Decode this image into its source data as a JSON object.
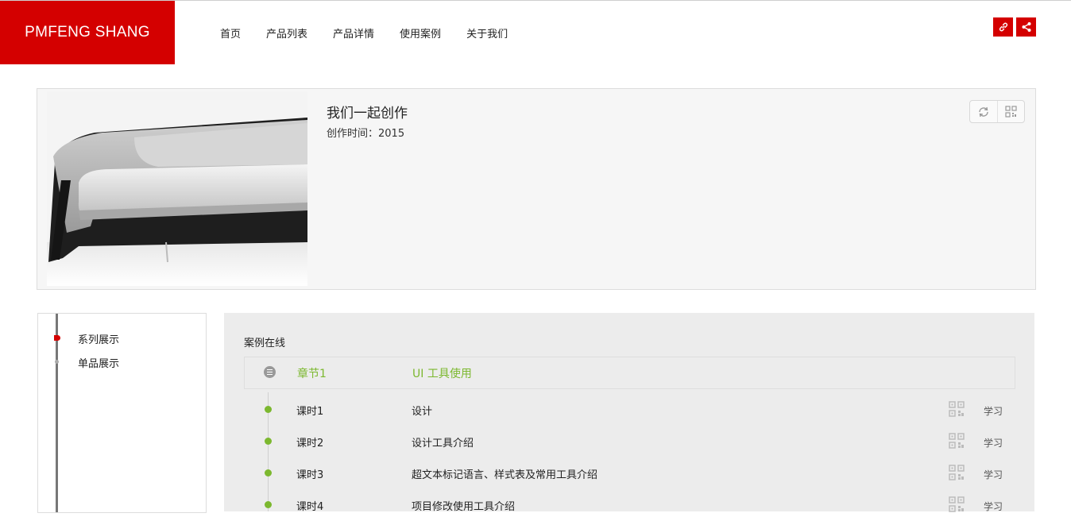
{
  "header": {
    "logo": "PMFENG SHANG",
    "nav": [
      "首页",
      "产品列表",
      "产品详情",
      "使用案例",
      "关于我们"
    ],
    "actions": [
      {
        "icon": "link-icon"
      },
      {
        "icon": "share-icon"
      }
    ]
  },
  "hero": {
    "title": "我们一起创作",
    "date": "创作时间：2015",
    "tools": [
      {
        "icon": "refresh-icon"
      },
      {
        "icon": "qrcode-icon"
      }
    ]
  },
  "sidebar": {
    "items": [
      {
        "label": "系列展示",
        "active": true
      },
      {
        "label": "单品展示",
        "active": false
      }
    ]
  },
  "main": {
    "title": "案例在线",
    "chapter": {
      "label": "章节1",
      "name": "UI 工具使用"
    },
    "lessons": [
      {
        "label": "课时1",
        "name": "设计",
        "action": "学习"
      },
      {
        "label": "课时2",
        "name": "设计工具介绍",
        "action": "学习"
      },
      {
        "label": "课时3",
        "name": "超文本标记语言、样式表及常用工具介绍",
        "action": "学习"
      },
      {
        "label": "课时4",
        "name": "项目修改使用工具介绍",
        "action": "学习"
      }
    ]
  },
  "colors": {
    "brand": "#d40000",
    "accent": "#7cb82f"
  }
}
